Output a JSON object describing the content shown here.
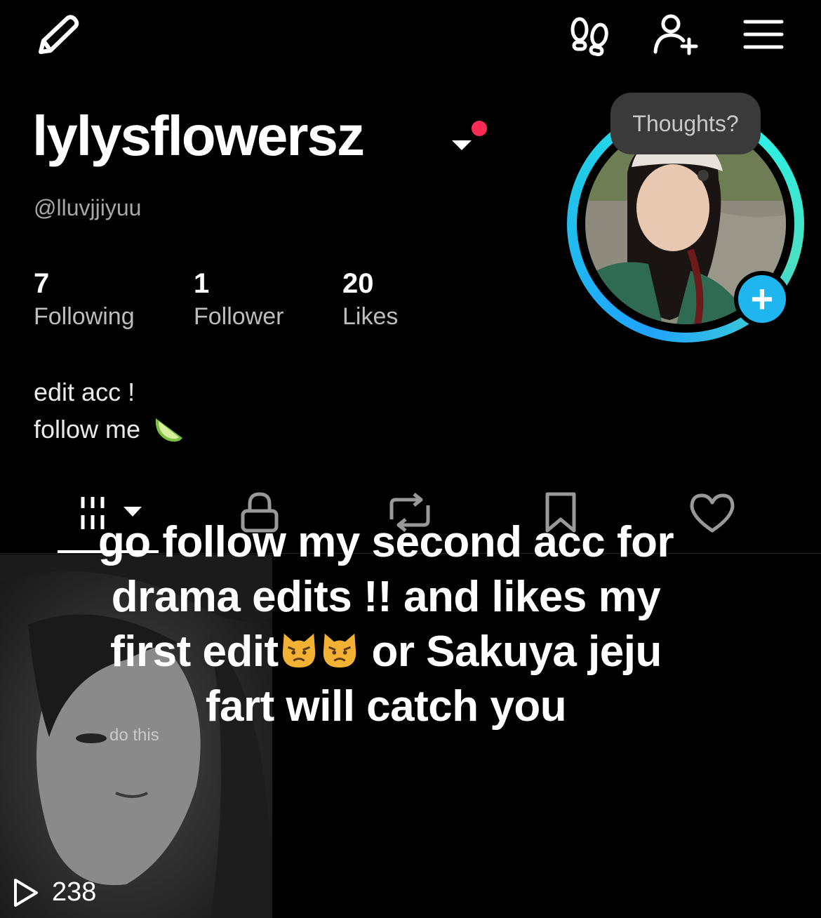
{
  "header": {
    "display_name": "lylysflowersz",
    "handle": "@lluvjjiyuu"
  },
  "stats": [
    {
      "value": "7",
      "label": "Following"
    },
    {
      "value": "1",
      "label": "Follower"
    },
    {
      "value": "20",
      "label": "Likes"
    }
  ],
  "bio": {
    "line1": "edit acc !",
    "line2": "follow me"
  },
  "avatar": {
    "thoughts_label": "Thoughts?"
  },
  "tabs": [
    "videos-grid",
    "private-lock",
    "reposts",
    "favorites",
    "liked"
  ],
  "overlay": {
    "part1": "go follow my second acc for drama edits !! and likes my first edit",
    "part2": " or Sakuya jeju fart will catch you"
  },
  "video": {
    "caption": "do this",
    "views": "238"
  },
  "colors": {
    "accent_red": "#fe2c55",
    "accent_cyan": "#25f4ee",
    "accent_blue": "#1fb6f0"
  }
}
